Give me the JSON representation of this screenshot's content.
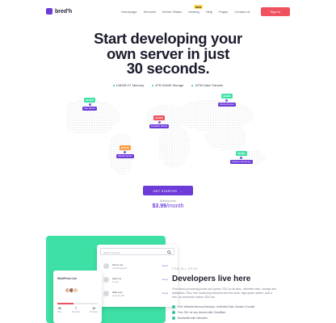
{
  "brand": {
    "name": "bred'h",
    "accent": "#6c3bd8",
    "highlight": "#ffd84d",
    "red": "#f0515e",
    "green": "#3ee0a5"
  },
  "nav": {
    "items": [
      "Homepage",
      "Services",
      "Server Status",
      "Hosting",
      "Help",
      "Pages",
      "Contact us"
    ],
    "new_badge": "NEW",
    "signin_label": "Sign In"
  },
  "hero": {
    "title_line1": "Start developing your",
    "title_line2": "own server in just",
    "title_line3": "30 seconds.",
    "features": [
      "128GB OT Memory",
      "4TB NVME Storage",
      "20TB Data Transfer"
    ]
  },
  "map_pins": [
    {
      "flag": "99.99%",
      "flag_color": "#3ee0a5",
      "location": "Lille Server"
    },
    {
      "flag": "99.98%",
      "flag_color": "#3ee0a5",
      "location": "Vienna Server"
    },
    {
      "flag": "99.95%",
      "flag_color": "#f0515e",
      "location": "Frankfurt Server"
    },
    {
      "flag": "99.97%",
      "flag_color": "#ff9a3c",
      "location": "Atlanta Server"
    },
    {
      "flag": "99.99%",
      "flag_color": "#3ee0a5",
      "location": "Ashburn VA Server"
    }
  ],
  "cta": {
    "button_label": "GET STARTED",
    "arrow_icon": "arrow-right-icon",
    "starting_text": "Starting from",
    "price": "$3.99",
    "per": "/month"
  },
  "search_card": {
    "placeholder": "Search servers",
    "rows": [
      {
        "name": "Server 1a",
        "sub": "United Kingdom",
        "action": "Go to"
      },
      {
        "name": "Lille1 us",
        "sub": "France",
        "action": "Go to"
      },
      {
        "name": "Web Live",
        "sub": "Germany 5th",
        "action": "Go to"
      }
    ]
  },
  "wp_card": {
    "title": "WordPress Live",
    "progress": 0.4,
    "stats": [
      {
        "value": "24",
        "label": "Sites"
      },
      {
        "value": "7",
        "label": "Domains"
      },
      {
        "value": "12",
        "label": "Backups"
      }
    ]
  },
  "developers": {
    "eyebrow": "FOR ALL DEVS",
    "title": "Developers live here",
    "body": "Fine-tuned processing power and speed, SSL for all sites, unlimited sites, storage and databases. Plus, free monitoring domains and free tools, high-grade uptime, plus a free, no-nonsense custom-SSL tool.",
    "list": [
      "Free Website Memory Backups, Unlimited Data Transfer & Install",
      "Free SSL for any domain with Cloudflare",
      "Bandwidth with Networks"
    ]
  }
}
